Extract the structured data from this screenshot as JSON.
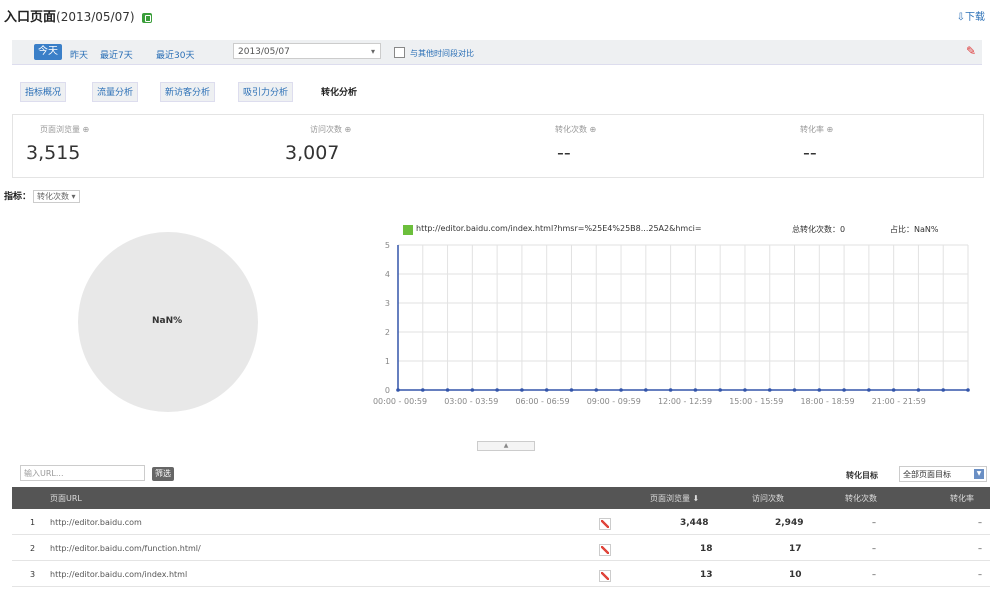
{
  "page": {
    "title": "入口页面",
    "date_title": "(2013/05/07)",
    "download": "⇩下载"
  },
  "toolbar": {
    "today": "今天",
    "yesterday": "昨天",
    "last7": "最近7天",
    "last30": "最近30天",
    "date_value": "2013/05/07",
    "compare_label": "与其他时间段对比"
  },
  "tabs": [
    "指标概况",
    "流量分析",
    "新访客分析",
    "吸引力分析",
    "转化分析"
  ],
  "metrics": [
    {
      "label": "页面浏览量 ⊕",
      "value": "3,515"
    },
    {
      "label": "访问次数 ⊕",
      "value": "3,007"
    },
    {
      "label": "转化次数 ⊕",
      "value": "--"
    },
    {
      "label": "转化率 ⊕",
      "value": "--"
    }
  ],
  "indicator": {
    "label": "指标：",
    "value": "转化次数 ▾"
  },
  "pie": {
    "label": "NaN%"
  },
  "legend": {
    "url": "http://editor.baidu.com/index.html?hmsr=%25E4%25B8...25A2&hmci=",
    "total": "总转化次数：0",
    "ratio": "占比：NaN%"
  },
  "chart_data": {
    "type": "line",
    "categories": [
      "00:00 - 00:59",
      "03:00 - 03:59",
      "06:00 - 06:59",
      "09:00 - 09:59",
      "12:00 - 12:59",
      "15:00 - 15:59",
      "18:00 - 18:59",
      "21:00 - 21:59"
    ],
    "yticks": [
      0,
      1,
      2,
      3,
      4,
      5
    ],
    "ylim": [
      0,
      5
    ],
    "series": [
      {
        "name": "http://editor.baidu.com/index.html?hmsr=%25E4%25B8...25A2&hmci=",
        "values": [
          0,
          0,
          0,
          0,
          0,
          0,
          0,
          0,
          0,
          0,
          0,
          0,
          0,
          0,
          0,
          0,
          0,
          0,
          0,
          0,
          0,
          0,
          0,
          0
        ]
      }
    ],
    "colors": {
      "series": "#6cbf3c",
      "axis": "#3355aa"
    }
  },
  "filter": {
    "url_placeholder": "输入URL...",
    "button": "筛选",
    "goal_label": "转化目标",
    "goal_value": "全部页面目标"
  },
  "table": {
    "headers": [
      "页面URL",
      "页面浏览量 ⬇",
      "访问次数",
      "转化次数",
      "转化率"
    ],
    "rows": [
      {
        "idx": "1",
        "url": "http://editor.baidu.com",
        "pv": "3,448",
        "visits": "2,949",
        "conv": "–",
        "rate": "–"
      },
      {
        "idx": "2",
        "url": "http://editor.baidu.com/function.html/",
        "pv": "18",
        "visits": "17",
        "conv": "–",
        "rate": "–"
      },
      {
        "idx": "3",
        "url": "http://editor.baidu.com/index.html",
        "pv": "13",
        "visits": "10",
        "conv": "–",
        "rate": "–"
      }
    ]
  }
}
